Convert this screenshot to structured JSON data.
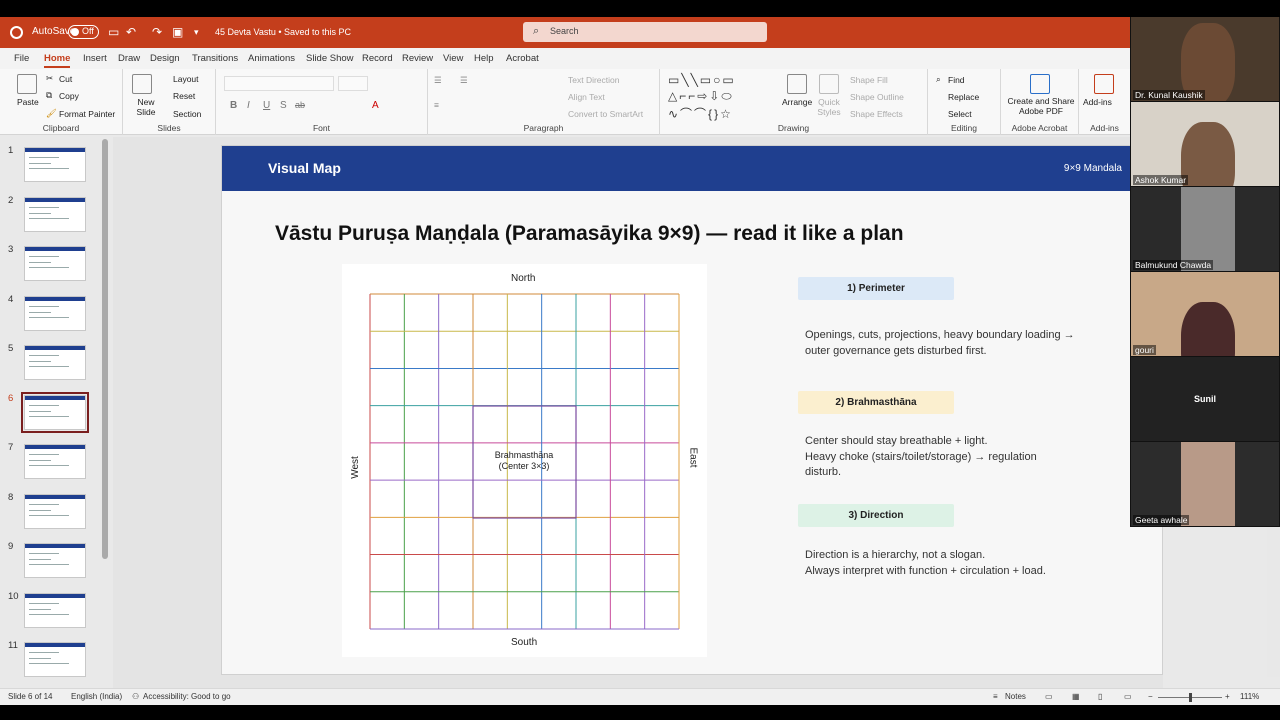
{
  "titlebar": {
    "autosave": "AutoSave",
    "toggle": "Off",
    "doc_title": "45 Devta Vastu  •  Saved to this PC",
    "search_placeholder": "Search"
  },
  "menu": [
    "File",
    "Home",
    "Insert",
    "Draw",
    "Design",
    "Transitions",
    "Animations",
    "Slide Show",
    "Record",
    "Review",
    "View",
    "Help",
    "Acrobat"
  ],
  "ribbon": {
    "clipboard": {
      "paste": "Paste",
      "cut": "Cut",
      "copy": "Copy",
      "format_painter": "Format Painter",
      "label": "Clipboard"
    },
    "slides": {
      "new_slide": "New Slide",
      "layout": "Layout",
      "reset": "Reset",
      "section": "Section",
      "label": "Slides"
    },
    "font": {
      "label": "Font",
      "bold": "B",
      "italic": "I",
      "underline": "U",
      "shadow": "S",
      "strike": "ab"
    },
    "paragraph": {
      "label": "Paragraph",
      "text_direction": "Text Direction",
      "align_text": "Align Text",
      "convert": "Convert to SmartArt"
    },
    "drawing": {
      "label": "Drawing",
      "arrange": "Arrange",
      "quick_styles": "Quick Styles",
      "shape_fill": "Shape Fill",
      "shape_outline": "Shape Outline",
      "shape_effects": "Shape Effects"
    },
    "editing": {
      "label": "Editing",
      "find": "Find",
      "replace": "Replace",
      "select": "Select"
    },
    "acrobat": {
      "label": "Adobe Acrobat",
      "btn": "Create and Share Adobe PDF"
    },
    "addins": {
      "label": "Add-ins",
      "btn": "Add-ins"
    }
  },
  "thumbnails": [
    "1",
    "2",
    "3",
    "4",
    "5",
    "6",
    "7",
    "8",
    "9",
    "10",
    "11"
  ],
  "selected_slide": "6",
  "slide": {
    "header_title": "Visual Map",
    "header_right": "9×9 Mandala",
    "title": "Vāstu Puruṣa Maṇḍala (Paramasāyika 9×9) — read it like a plan",
    "north": "North",
    "south": "South",
    "west": "West",
    "east": "East",
    "center_label1": "Brahmasthāna",
    "center_label2": "(Center 3×3)",
    "cards": [
      {
        "title": "1) Perimeter",
        "color": "#dce9f7",
        "lines": [
          "Openings, cuts, projections, heavy boundary loading →",
          "outer governance gets disturbed first."
        ]
      },
      {
        "title": "2) Brahmasthāna",
        "color": "#fbefcf",
        "lines": [
          "Center should stay breathable + light.",
          "Heavy choke (stairs/toilet/storage) → regulation",
          "disturb."
        ]
      },
      {
        "title": "3) Direction",
        "color": "#ddf2e6",
        "lines": [
          "Direction is a hierarchy, not a slogan.",
          "Always interpret with function + circulation + load."
        ]
      }
    ]
  },
  "participants": [
    {
      "name": "Dr. Kunal Kaushik"
    },
    {
      "name": "Ashok Kumar"
    },
    {
      "name": "Balmukund Chawda"
    },
    {
      "name": "gouri"
    },
    {
      "name": "Sunil"
    },
    {
      "name": "Geeta awhale"
    }
  ],
  "status": {
    "slide_of": "Slide 6 of 14",
    "language": "English (India)",
    "accessibility": "Accessibility: Good to go",
    "notes": "Notes",
    "zoom": "111%"
  }
}
